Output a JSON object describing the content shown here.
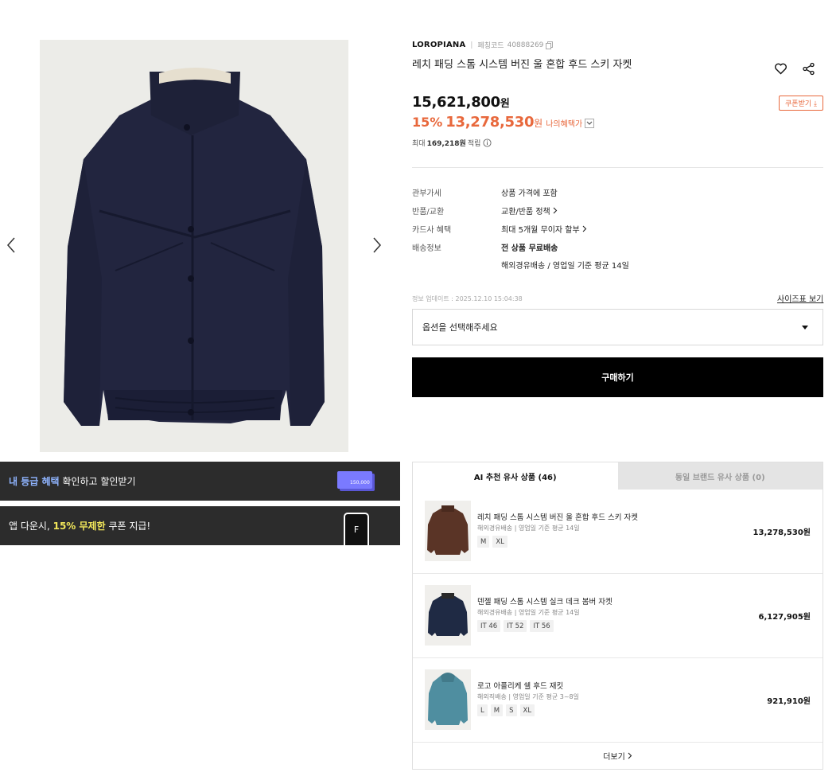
{
  "gallery": {
    "prev_icon": "chevron-left-icon",
    "next_icon": "chevron-right-icon"
  },
  "banners": {
    "grade": {
      "highlight": "내 등급 혜택",
      "rest": " 확인하고 할인받기",
      "card_text": "150,000"
    },
    "app": {
      "prefix": "앱 다운시, ",
      "highlight": "15% 무제한",
      "suffix": " 쿠폰 지급!",
      "phone_letter": "F"
    }
  },
  "product": {
    "brand": "LOROPIANA",
    "code_label": "페칭코드",
    "code_value": "40888269",
    "title": "레치 패딩 스톰 시스템 버진 울 혼합 후드 스키 자켓",
    "price_original": "15,621,800",
    "currency": "원",
    "coupon_label": "쿠폰받기 ⤓",
    "discount": "15%",
    "price_sale": "13,278,530",
    "my_benefit": "나의혜택가",
    "points_prefix": "최대",
    "points_value": "169,218원",
    "points_suffix": "적립"
  },
  "details": [
    {
      "label": "관부가세",
      "value": "상품 가격에 포함"
    },
    {
      "label": "반품/교환",
      "value": "교환/반품 정책"
    },
    {
      "label": "카드사 혜택",
      "value": "최대 5개월 무이자 할부"
    },
    {
      "label": "배송정보",
      "value": "전 상품 무료배송",
      "value2": "해외경유배송 / 영업일 기준 평균 14일"
    }
  ],
  "purchase": {
    "update_time": "정보 업데이트 : 2025.12.10 15:04:38",
    "size_guide": "사이즈표 보기",
    "option_placeholder": "옵션을 선택해주세요",
    "buy_label": "구매하기"
  },
  "reco": {
    "tab_active": "AI 추천 유사 상품 (46)",
    "tab_inactive": "동일 브랜드 유사 상품 (0)",
    "items": [
      {
        "name": "레치 패딩 스톰 시스템 버진 울 혼합 후드 스키 자켓",
        "ship": "해외경유배송 | 영업일 기준 평균 14일",
        "sizes": [
          "M",
          "XL"
        ],
        "price": "13,278,530원",
        "color": "#5a3426"
      },
      {
        "name": "덴젤 패딩 스톰 시스템 실크 데크 봄버 자켓",
        "ship": "해외경유배송 | 영업일 기준 평균 14일",
        "sizes": [
          "IT 46",
          "IT 52",
          "IT 56"
        ],
        "price": "6,127,905원",
        "color": "#1f2a44"
      },
      {
        "name": "로고 아플리케 쉘 후드 재킷",
        "ship": "해외직배송 | 영업일 기준 평균 3~8일",
        "sizes": [
          "L",
          "M",
          "S",
          "XL"
        ],
        "price": "921,910원",
        "color": "#4f8ea0"
      }
    ],
    "more_label": "더보기"
  }
}
